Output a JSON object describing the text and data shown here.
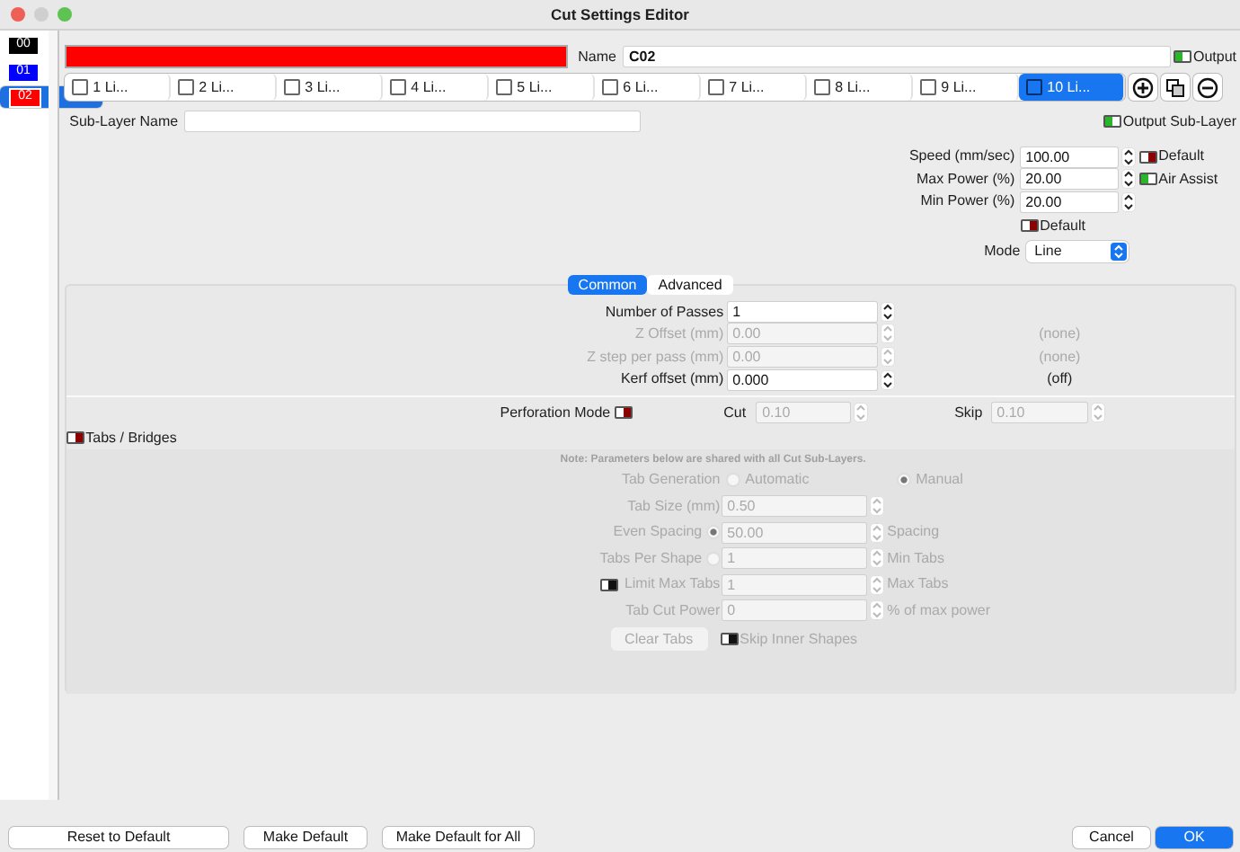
{
  "window": {
    "title": "Cut Settings Editor"
  },
  "layers": [
    {
      "label": "00",
      "color": "#000000",
      "selected": false
    },
    {
      "label": "01",
      "color": "#0000ff",
      "selected": false
    },
    {
      "label": "02",
      "color": "#ff0000",
      "selected": true
    }
  ],
  "layer_header": {
    "color": "#ff0000",
    "name_label": "Name",
    "name": "C02",
    "output": {
      "label": "Output",
      "on": true
    }
  },
  "sublayers": [
    {
      "label": "1 Li...",
      "checked": false,
      "selected": false
    },
    {
      "label": "2 Li...",
      "checked": false,
      "selected": false
    },
    {
      "label": "3 Li...",
      "checked": false,
      "selected": false
    },
    {
      "label": "4 Li...",
      "checked": false,
      "selected": false
    },
    {
      "label": "5 Li...",
      "checked": false,
      "selected": false
    },
    {
      "label": "6 Li...",
      "checked": false,
      "selected": false
    },
    {
      "label": "7 Li...",
      "checked": false,
      "selected": false
    },
    {
      "label": "8 Li...",
      "checked": false,
      "selected": false
    },
    {
      "label": "9 Li...",
      "checked": false,
      "selected": false
    },
    {
      "label": "10 Li...",
      "checked": false,
      "selected": true
    }
  ],
  "sublayer_name": {
    "label": "Sub-Layer Name"
  },
  "output_sublayer": {
    "label": "Output Sub-Layer",
    "on": true
  },
  "settings": [
    {
      "label": "Speed (mm/sec)",
      "value": "100.00",
      "toggle": {
        "label": "Default",
        "on": false
      }
    },
    {
      "label": "Max Power (%)",
      "value": "20.00",
      "toggle": {
        "label": "Air Assist",
        "on": true
      }
    },
    {
      "label": "Min Power (%)",
      "value": "20.00"
    }
  ],
  "default_toggle": {
    "label": "Default",
    "on": false
  },
  "mode": {
    "label": "Mode",
    "value": "Line"
  },
  "tabs": [
    {
      "label": "Common",
      "selected": true
    },
    {
      "label": "Advanced",
      "selected": false
    }
  ],
  "common": {
    "rows": [
      {
        "label": "Number of Passes",
        "value": "1",
        "disabled": false
      },
      {
        "label": "Z Offset (mm)",
        "value": "0.00",
        "disabled": true,
        "note": "(none)"
      },
      {
        "label": "Z step per pass (mm)",
        "value": "0.00",
        "disabled": true,
        "note": "(none)"
      },
      {
        "label": "Kerf offset (mm)",
        "value": "0.000",
        "disabled": false,
        "note": "(off)"
      }
    ],
    "perforation": {
      "label": "Perforation Mode",
      "on": false,
      "cut_label": "Cut",
      "cut": "0.10",
      "skip_label": "Skip",
      "skip": "0.10"
    }
  },
  "tabs_bridges": {
    "label": "Tabs / Bridges",
    "on": false,
    "disabled": true,
    "note": "Note: Parameters below are shared with all Cut Sub-Layers.",
    "generation": {
      "label": "Tab Generation",
      "options": [
        {
          "label": "Automatic",
          "selected": false
        },
        {
          "label": "Manual",
          "selected": true
        }
      ]
    },
    "tab_size": {
      "label": "Tab Size (mm)",
      "value": "0.50"
    },
    "even_spacing": {
      "label": "Even Spacing",
      "selected": true,
      "value": "50.00",
      "suffix": "Spacing"
    },
    "per_shape": {
      "label": "Tabs Per Shape",
      "selected": false,
      "value": "1",
      "suffix": "Min Tabs"
    },
    "limit_max": {
      "label": "Limit Max Tabs",
      "on": false,
      "value": "1",
      "suffix": "Max Tabs"
    },
    "cut_power": {
      "label": "Tab Cut Power",
      "value": "0",
      "suffix": "% of max power"
    },
    "clear_button": "Clear Tabs",
    "skip_inner": {
      "label": "Skip Inner Shapes",
      "on": false
    }
  },
  "footer": {
    "left": [
      "Reset to Default",
      "Make Default",
      "Make Default for All"
    ],
    "right": [
      {
        "label": "Cancel",
        "primary": false
      },
      {
        "label": "OK",
        "primary": true
      }
    ]
  }
}
